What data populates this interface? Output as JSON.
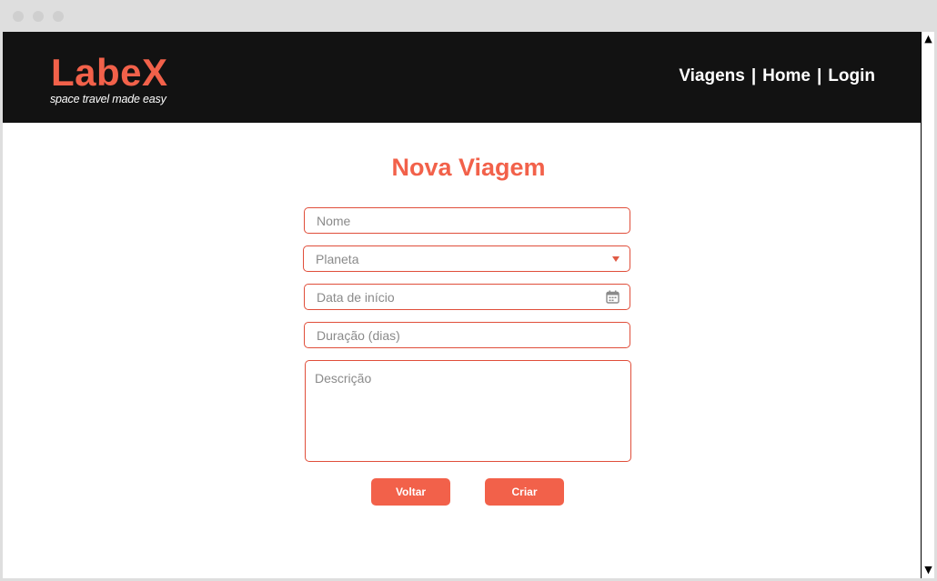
{
  "header": {
    "logo": "LabeX",
    "tagline": "space travel made easy",
    "nav": [
      {
        "label": "Viagens"
      },
      {
        "label": "Home"
      },
      {
        "label": "Login"
      }
    ],
    "separator": "|",
    "background_color": "#121212",
    "brand_color": "#f2614a"
  },
  "form": {
    "title": "Nova Viagem",
    "fields": {
      "nome": {
        "placeholder": "Nome",
        "value": ""
      },
      "planeta": {
        "placeholder": "Planeta",
        "icon": "chevron-down-icon"
      },
      "data": {
        "placeholder": "Data de início",
        "icon": "calendar-icon"
      },
      "duracao": {
        "placeholder": "Duração (dias)",
        "value": ""
      },
      "descricao": {
        "placeholder": "Descrição",
        "value": ""
      }
    },
    "buttons": {
      "voltar": "Voltar",
      "criar": "Criar"
    },
    "accent_color": "#f2614a"
  },
  "scrollbar": {
    "up": "▲",
    "down": "▼"
  }
}
